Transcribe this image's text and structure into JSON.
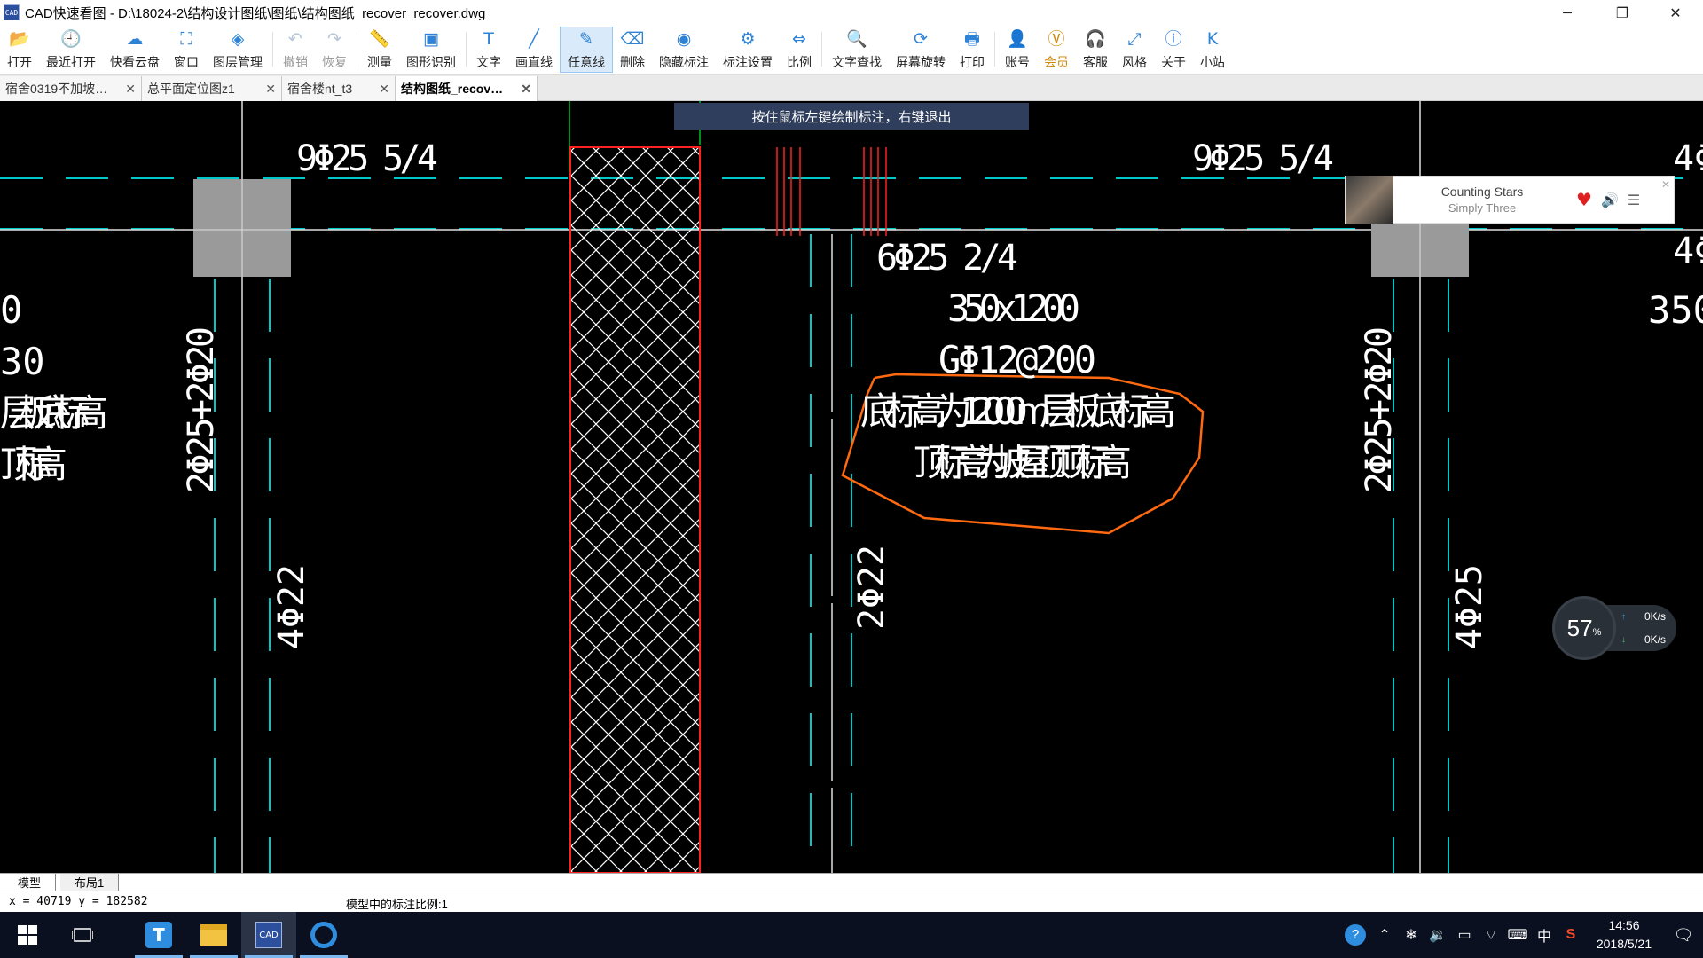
{
  "window": {
    "title": "CAD快速看图 - D:\\18024-2\\结构设计图纸\\图纸\\结构图纸_recover_recover.dwg",
    "app_icon_text": "CAD",
    "minimize": "─",
    "maximize": "❐",
    "close": "✕"
  },
  "toolbar": {
    "items": [
      {
        "label": "打开",
        "icon": "folder-open-icon",
        "glyph": "📂"
      },
      {
        "label": "最近打开",
        "icon": "clock-icon",
        "glyph": "🕘"
      },
      {
        "label": "快看云盘",
        "icon": "cloud-icon",
        "glyph": "☁"
      },
      {
        "label": "窗口",
        "icon": "fullscreen-icon",
        "glyph": "⛶"
      },
      {
        "label": "图层管理",
        "icon": "layers-icon",
        "glyph": "◈"
      },
      {
        "label": "撤销",
        "icon": "undo-icon",
        "glyph": "↶",
        "disabled": true
      },
      {
        "label": "恢复",
        "icon": "redo-icon",
        "glyph": "↷",
        "disabled": true
      },
      {
        "label": "测量",
        "icon": "ruler-icon",
        "glyph": "📏"
      },
      {
        "label": "图形识别",
        "icon": "shape-recognize-icon",
        "glyph": "▣"
      },
      {
        "label": "文字",
        "icon": "text-icon",
        "glyph": "T"
      },
      {
        "label": "画直线",
        "icon": "line-icon",
        "glyph": "╱"
      },
      {
        "label": "任意线",
        "icon": "pencil-icon",
        "glyph": "✎",
        "active": true
      },
      {
        "label": "删除",
        "icon": "eraser-icon",
        "glyph": "⌫"
      },
      {
        "label": "隐藏标注",
        "icon": "eye-off-icon",
        "glyph": "◉"
      },
      {
        "label": "标注设置",
        "icon": "annotation-settings-icon",
        "glyph": "⚙"
      },
      {
        "label": "比例",
        "icon": "ratio-icon",
        "glyph": "⇔"
      },
      {
        "label": "文字查找",
        "icon": "text-search-icon",
        "glyph": "🔍"
      },
      {
        "label": "屏幕旋转",
        "icon": "rotate-screen-icon",
        "glyph": "⟳"
      },
      {
        "label": "打印",
        "icon": "printer-icon",
        "glyph": "🖶"
      },
      {
        "label": "账号",
        "icon": "user-icon",
        "glyph": "👤"
      },
      {
        "label": "会员",
        "icon": "vip-icon",
        "glyph": "Ⓥ",
        "vip": true
      },
      {
        "label": "客服",
        "icon": "headset-icon",
        "glyph": "🎧"
      },
      {
        "label": "风格",
        "icon": "style-icon",
        "glyph": "⤢"
      },
      {
        "label": "关于",
        "icon": "info-icon",
        "glyph": "ⓘ"
      },
      {
        "label": "小站",
        "icon": "site-icon",
        "glyph": "K"
      }
    ]
  },
  "tabs": [
    {
      "label": "宿舍0319不加坡…",
      "close": "✕",
      "active": false
    },
    {
      "label": "总平面定位图z1",
      "close": "✕",
      "active": false
    },
    {
      "label": "宿舍楼nt_t3",
      "close": "✕",
      "active": false
    },
    {
      "label": "结构图纸_recov…",
      "close": "✕",
      "active": true
    }
  ],
  "drawing": {
    "hint": "按住鼠标左键绘制标注，右键退出",
    "labels": {
      "top_left_rebar": "9Φ25 5/4",
      "top_right_rebar": "9Φ25 5/4",
      "right_edge_rebar_top": "4Φ",
      "right_edge_rebar_2": "4Φ",
      "middle_rebar": "6Φ25 2/4",
      "beam_size": "350x1200",
      "stirrup": "GΦ12@200",
      "note_line1": "底标高为12.000m层板底标高",
      "note_line2": "顶标高为坡屋顶顶标高",
      "left_partial_1": "0",
      "left_partial_2": "30",
      "left_partial_3": "层板底标高",
      "left_partial_4": "顶标高",
      "right_partial_size": "350",
      "vertical_left": "2Φ25+2Φ20",
      "vertical_right": "2Φ25+2Φ20",
      "vertical_4phi22": "4Φ22",
      "vertical_2phi22": "2Φ22",
      "vertical_4phi25": "4Φ25"
    },
    "colors": {
      "background": "#000000",
      "text": "#ffffff",
      "dashed": "#00c8c8",
      "hatch": "#ffffff",
      "hatch_border": "#ff2020",
      "column": "#9a9a9a",
      "markup": "#ff6a10"
    }
  },
  "music": {
    "title": "Counting Stars",
    "artist": "Simply Three",
    "close": "✕"
  },
  "perf": {
    "cpu_value": "57",
    "cpu_unit": "%",
    "upload_arrow": "↑",
    "upload": "0K/s",
    "download_arrow": "↓",
    "download": "0K/s"
  },
  "layout_tabs": [
    "模型",
    "布局1"
  ],
  "status": {
    "coords": "x = 40719 y = 182582",
    "scale": "模型中的标注比例:1"
  },
  "taskbar": {
    "tray_ime": "中",
    "tray_sogou": "S",
    "time": "14:56",
    "date": "2018/5/21"
  }
}
